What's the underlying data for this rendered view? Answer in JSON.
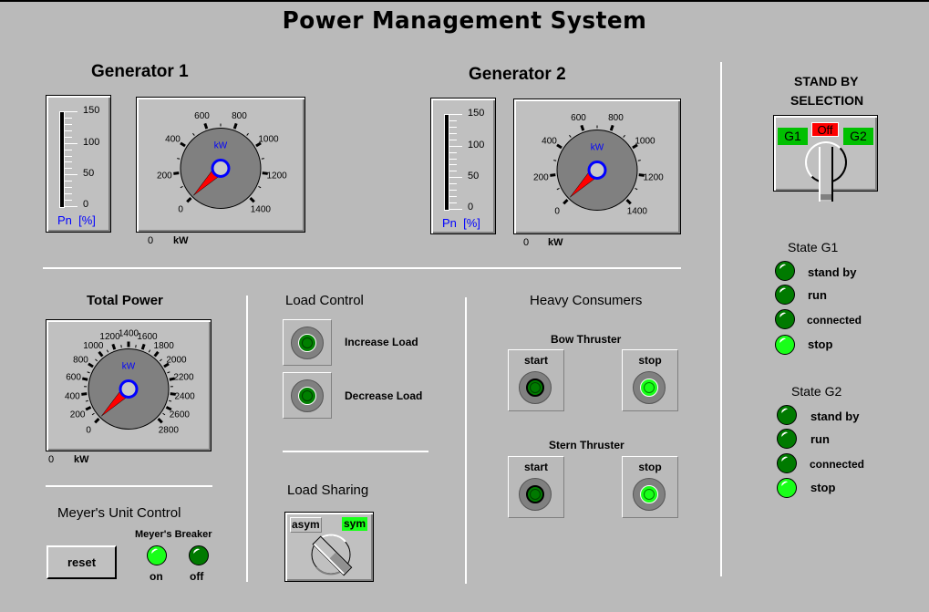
{
  "title": "Power Management System",
  "generator1": {
    "title": "Generator 1",
    "bar": {
      "scale": [
        "150",
        "100",
        "50",
        "0"
      ],
      "unit_label": "Pn  [%]",
      "value_percent": 0
    },
    "dial": {
      "unit": "kW",
      "ticks": [
        "0",
        "200",
        "400",
        "600",
        "800",
        "1000",
        "1200",
        "1400"
      ],
      "min": 0,
      "max": 1400,
      "value": 0
    },
    "readout_value": "0",
    "readout_unit": "kW"
  },
  "generator2": {
    "title": "Generator 2",
    "bar": {
      "scale": [
        "150",
        "100",
        "50",
        "0"
      ],
      "unit_label": "Pn  [%]",
      "value_percent": 0
    },
    "dial": {
      "unit": "kW",
      "ticks": [
        "0",
        "200",
        "400",
        "600",
        "800",
        "1000",
        "1200",
        "1400"
      ],
      "min": 0,
      "max": 1400,
      "value": 0
    },
    "readout_value": "0",
    "readout_unit": "kW"
  },
  "standby": {
    "title_line1": "STAND BY",
    "title_line2": "SELECTION",
    "options": [
      "G1",
      "Off",
      "G2"
    ],
    "selected": "Off",
    "colors": {
      "g": "#00c000",
      "off": "#ff0000"
    }
  },
  "state_g1": {
    "title": "State G1",
    "items": [
      {
        "label": "stand by",
        "on": false
      },
      {
        "label": "run",
        "on": false
      },
      {
        "label": "connected",
        "on": false
      },
      {
        "label": "stop",
        "on": true
      }
    ]
  },
  "state_g2": {
    "title": "State G2",
    "items": [
      {
        "label": "stand by",
        "on": false
      },
      {
        "label": "run",
        "on": false
      },
      {
        "label": "connected",
        "on": false
      },
      {
        "label": "stop",
        "on": true
      }
    ]
  },
  "total_power": {
    "title": "Total Power",
    "dial": {
      "unit": "kW",
      "ticks": [
        "0",
        "200",
        "400",
        "600",
        "800",
        "1000",
        "1200",
        "1400",
        "1600",
        "1800",
        "2000",
        "2200",
        "2400",
        "2600",
        "2800"
      ],
      "min": 0,
      "max": 2800,
      "value": 0
    },
    "readout_value": "0",
    "readout_unit": "kW"
  },
  "meyers": {
    "title": "Meyer's Unit Control",
    "reset_label": "reset",
    "breaker_label": "Meyer's Breaker",
    "on_label": "on",
    "off_label": "off",
    "breaker_on": true
  },
  "load_control": {
    "title": "Load Control",
    "increase_label": "Increase Load",
    "decrease_label": "Decrease Load"
  },
  "load_sharing": {
    "title": "Load Sharing",
    "asym_label": "asym",
    "sym_label": "sym",
    "selected": "sym"
  },
  "heavy_consumers": {
    "title": "Heavy Consumers",
    "bow": {
      "title": "Bow Thruster",
      "start_label": "start",
      "stop_label": "stop",
      "running": false
    },
    "stern": {
      "title": "Stern Thruster",
      "start_label": "start",
      "stop_label": "stop",
      "running": false
    }
  },
  "colors": {
    "background": "#bababa",
    "led_dark": "#007a00",
    "led_bright": "#19ff19",
    "needle": "#ff0000",
    "dial_face": "#808080",
    "hub": "#0000ff"
  }
}
